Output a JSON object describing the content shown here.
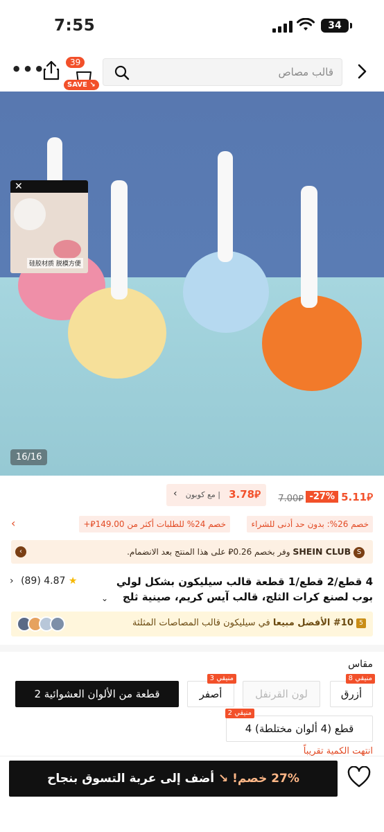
{
  "status_bar": {
    "time": "7:55",
    "battery": "34"
  },
  "nav": {
    "bag_count": "39",
    "save_label": "SAVE",
    "search_placeholder": "قالب مصاص"
  },
  "gallery": {
    "counter": "16/16",
    "mini_close": "✕",
    "mini_caption": "硅胶材质 脱模方便"
  },
  "price": {
    "current": "5.11⃁",
    "discount": "-27%",
    "original": "7.00⃁",
    "coupon_price": "3.78⃁",
    "coupon_label": "مع كوبون |"
  },
  "promos": [
    "خصم 26%: بدون حد أدنى للشراء",
    "خصم 24% للطلبات أكثر من 149.00⃁+"
  ],
  "club": {
    "brand": "SHEIN CLUB",
    "text": "وفر بخصم 0.26⃁ على هذا المنتج بعد الانضمام."
  },
  "product": {
    "title": "4 قطع/2 قطع/1 قطعة قالب سيليكون بشكل لولي بوب لصنع كرات الثلج، قالب آيس كريم، صينية ثلج للفريزر",
    "rating": "4.87",
    "reviews": "(89)"
  },
  "bestseller": {
    "rank": "#10 الأفضل مبيعا",
    "category": "في سيليكون قالب المصاصات المثلثة"
  },
  "size": {
    "title": "مقاس",
    "options": [
      {
        "label": "أزرق",
        "badge": "منيقي 8"
      },
      {
        "label": "لون القرنفل",
        "badge": ""
      },
      {
        "label": "أصفر",
        "badge": "منيقي 3"
      },
      {
        "label": "2 قطعة من الألوان العشوائية",
        "badge": ""
      },
      {
        "label": "4 قطع (4 ألوان مختلطة)",
        "badge": "منيقي 2"
      }
    ],
    "peek_text": "انتهت الكمية تقريباً"
  },
  "bottom_bar": {
    "discount_text": "27% خصم!",
    "add_to_cart": "أضف إلى عربة التسوق بنجاح"
  },
  "colors": {
    "accent": "#f2502a",
    "dark": "#111111",
    "coupon_bg": "#fdece6",
    "club_bg": "#fdf0e3",
    "best_bg": "#fff6dc"
  }
}
